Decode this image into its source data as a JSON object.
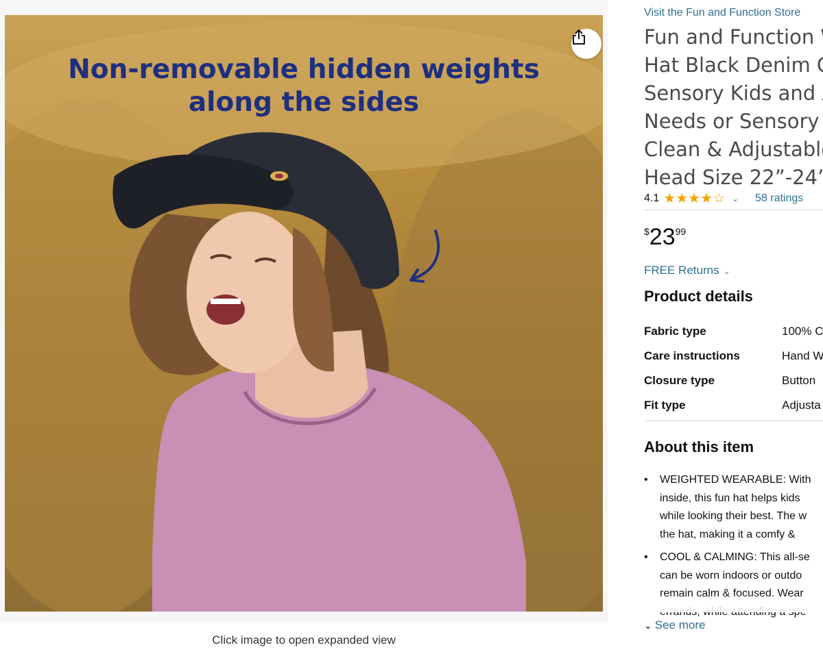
{
  "image_panel": {
    "headline": "Non-removable hidden weights\nalong the sides",
    "share_icon": "share-icon",
    "caption": "Click image to open expanded view"
  },
  "product": {
    "store_link": "Visit the Fun and Function Store",
    "title": "Fun and Function W\nHat Black Denim Ca\nSensory Kids and A\nNeeds or Sensory C\nClean & Adjustable\nHead Size 22”-24”",
    "rating": {
      "value": "4.1",
      "stars_filled": 4,
      "stars_total": 5,
      "count_label": "58 ratings"
    },
    "price": {
      "symbol": "$",
      "whole": "23",
      "fraction": "99"
    },
    "free_returns": "FREE Returns"
  },
  "product_details": {
    "heading": "Product details",
    "rows": [
      {
        "label": "Fabric type",
        "value": "100% C"
      },
      {
        "label": "Care instructions",
        "value": "Hand W"
      },
      {
        "label": "Closure type",
        "value": "Button"
      },
      {
        "label": "Fit type",
        "value": "Adjusta"
      }
    ]
  },
  "about": {
    "heading": "About this item",
    "bullets": [
      "WEIGHTED WEARABLE: With\ninside, this fun hat helps kids\nwhile looking their best. The w\nthe hat, making it a comfy &",
      "COOL & CALMING: This all-se\ncan be worn indoors or outdo\nremain calm & focused. Wear\nerrands, while attending a spe"
    ],
    "see_more": "See more"
  },
  "colors": {
    "link": "#2f6f8f",
    "headline": "#1f2f80",
    "star": "#f2a400"
  }
}
